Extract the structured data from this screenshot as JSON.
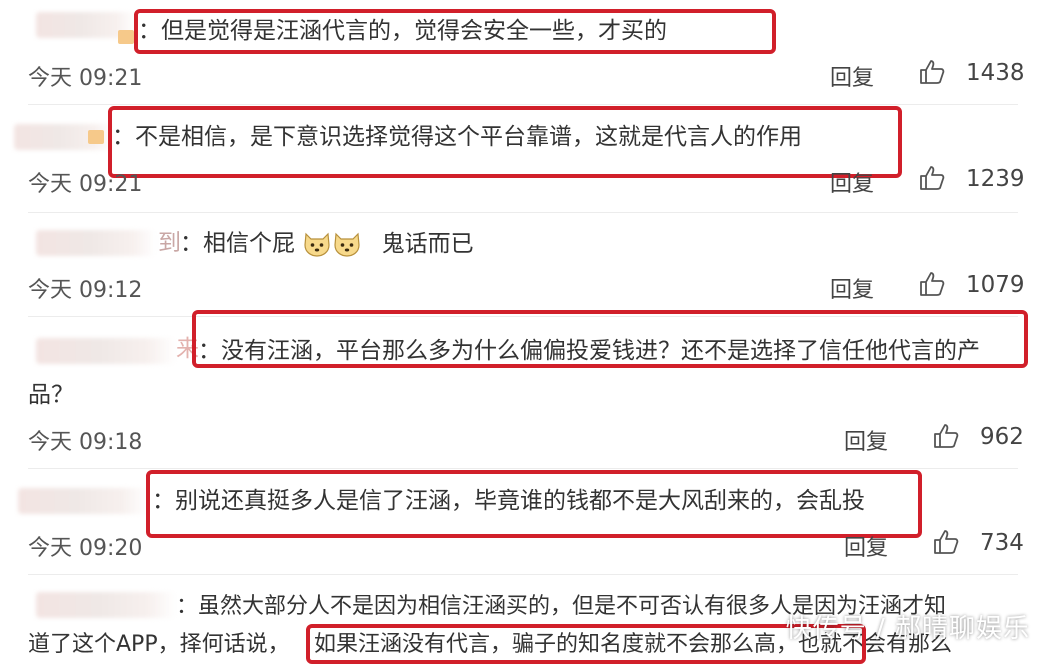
{
  "comments": [
    {
      "text": "：但是觉得是汪涵代言的，觉得会安全一些，才买的",
      "time": "今天 09:21",
      "reply": "回复",
      "likes": "1438"
    },
    {
      "text": "：不是相信，是下意识选择觉得这个平台靠谱，这就是代言人的作用",
      "time": "今天 09:21",
      "reply": "回复",
      "likes": "1239"
    },
    {
      "name_fragment": "到",
      "text_a": "：相信个屁",
      "text_b": "鬼话而已",
      "time": "今天 09:12",
      "reply": "回复",
      "likes": "1079"
    },
    {
      "name_fragment": "来",
      "text_line1": "：没有汪涵，平台那么多为什么偏偏投爱钱进？还不是选择了信任他代言的产",
      "text_line2": "品？",
      "time": "今天 09:18",
      "reply": "回复",
      "likes": "962"
    },
    {
      "text": "：别说还真挺多人是信了汪涵，毕竟谁的钱都不是大风刮来的，会乱投",
      "time": "今天 09:20",
      "reply": "回复",
      "likes": "734"
    },
    {
      "text_line1": "：虽然大部分人不是因为相信汪涵买的，但是不可否认有很多人是因为汪涵才知",
      "text_line2a": "道了这个APP，择何话说，",
      "text_line2b": "如果汪涵没有代言，骗子的知名度就不会那么高，也就不会有那么"
    }
  ],
  "emoji_name": "doge-emoji",
  "watermark": "快传号 / 郝晴聊娱乐",
  "colors": {
    "highlight": "#d11f2a",
    "text": "#333333"
  }
}
